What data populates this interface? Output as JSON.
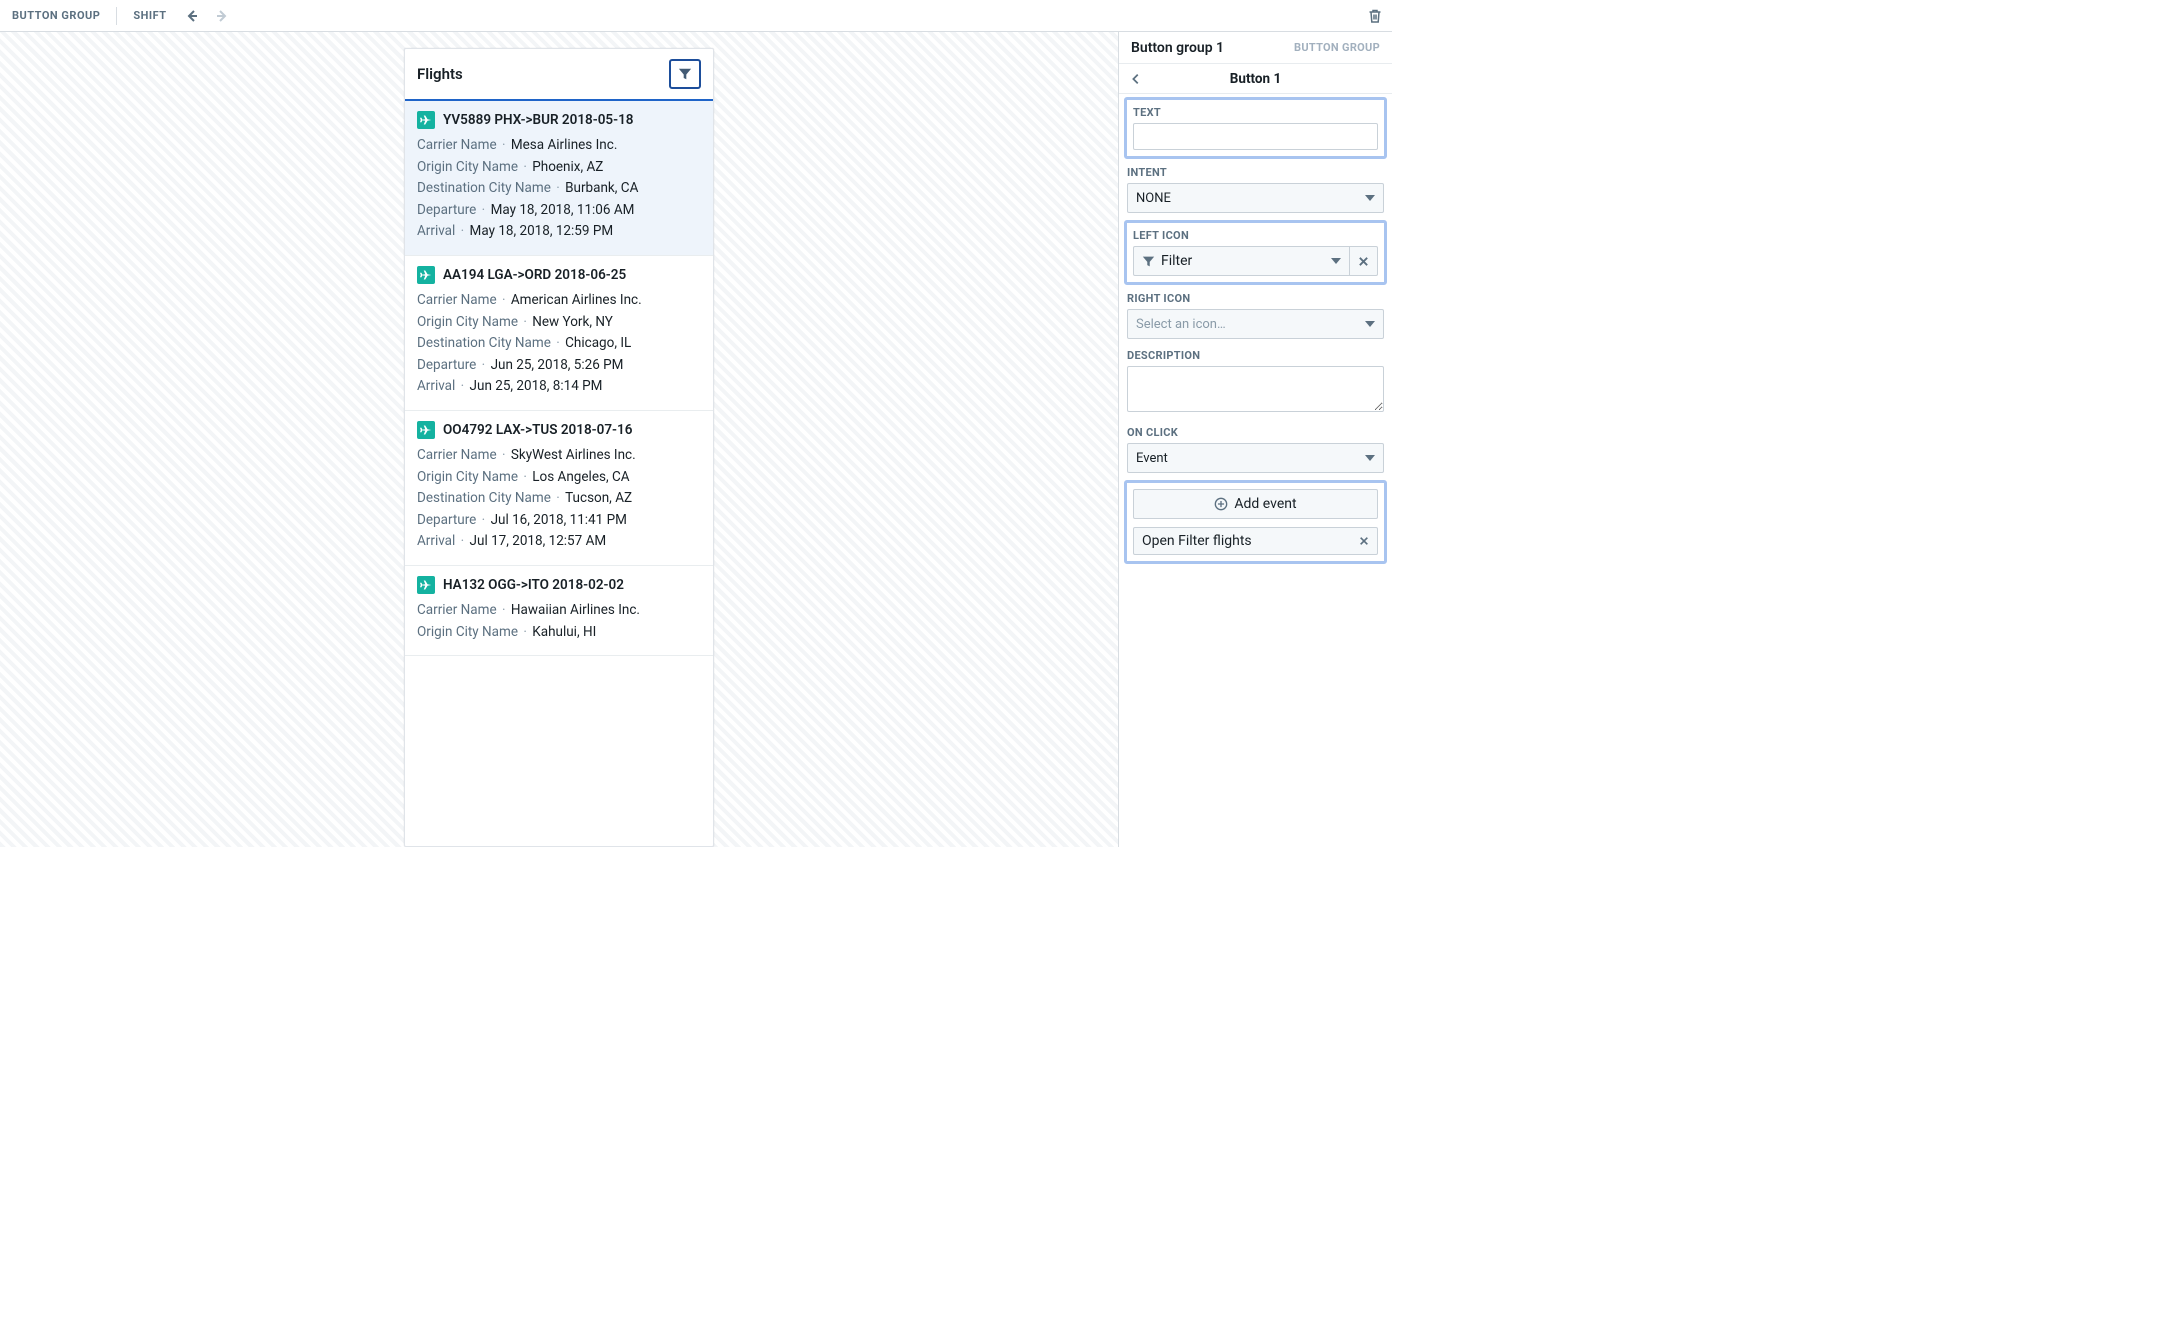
{
  "topbar": {
    "label_left": "BUTTON GROUP",
    "shift": "SHIFT"
  },
  "card": {
    "title": "Flights"
  },
  "list_labels": {
    "carrier": "Carrier Name",
    "origin": "Origin City Name",
    "dest": "Destination City Name",
    "departure": "Departure",
    "arrival": "Arrival"
  },
  "flights": [
    {
      "title": "YV5889 PHX->BUR 2018-05-18",
      "carrier": "Mesa Airlines Inc.",
      "origin": "Phoenix, AZ",
      "dest": "Burbank, CA",
      "departure": "May 18, 2018, 11:06 AM",
      "arrival": "May 18, 2018, 12:59 PM"
    },
    {
      "title": "AA194 LGA->ORD 2018-06-25",
      "carrier": "American Airlines Inc.",
      "origin": "New York, NY",
      "dest": "Chicago, IL",
      "departure": "Jun 25, 2018, 5:26 PM",
      "arrival": "Jun 25, 2018, 8:14 PM"
    },
    {
      "title": "OO4792 LAX->TUS 2018-07-16",
      "carrier": "SkyWest Airlines Inc.",
      "origin": "Los Angeles, CA",
      "dest": "Tucson, AZ",
      "departure": "Jul 16, 2018, 11:41 PM",
      "arrival": "Jul 17, 2018, 12:57 AM"
    },
    {
      "title": "HA132 OGG->ITO 2018-02-02",
      "carrier": "Hawaiian Airlines Inc.",
      "origin": "Kahului, HI",
      "dest": "",
      "departure": "",
      "arrival": ""
    }
  ],
  "panel": {
    "header_title": "Button group 1",
    "header_type": "BUTTON GROUP",
    "sub_title": "Button 1",
    "labels": {
      "text": "TEXT",
      "intent": "INTENT",
      "left_icon": "LEFT ICON",
      "right_icon": "RIGHT ICON",
      "description": "DESCRIPTION",
      "on_click": "ON CLICK"
    },
    "intent_value": "NONE",
    "left_icon_value": "Filter",
    "right_icon_placeholder": "Select an icon…",
    "on_click_value": "Event",
    "add_event_label": "Add event",
    "event_row_label": "Open Filter flights"
  }
}
